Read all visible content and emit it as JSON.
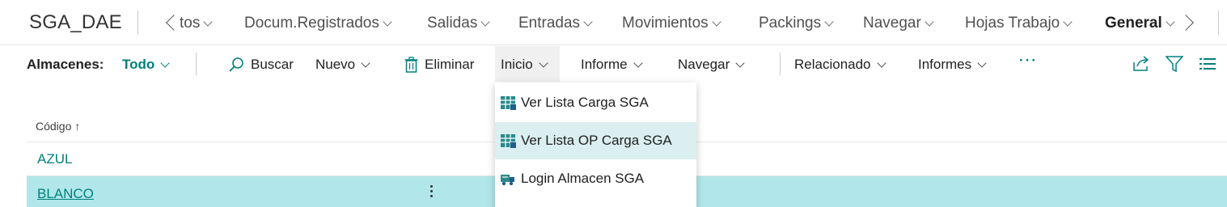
{
  "app": {
    "title": "SGA_DAE"
  },
  "topnav": {
    "items": [
      {
        "label": "tos"
      },
      {
        "label": "Docum.Registrados"
      },
      {
        "label": "Salidas"
      },
      {
        "label": "Entradas"
      },
      {
        "label": "Movimientos"
      },
      {
        "label": "Packings"
      },
      {
        "label": "Navegar"
      },
      {
        "label": "Hojas Trabajo"
      },
      {
        "label": "General"
      }
    ]
  },
  "actionbar": {
    "filter_label": "Almacenes:",
    "filter_value": "Todo",
    "buscar": "Buscar",
    "nuevo": "Nuevo",
    "eliminar": "Eliminar",
    "inicio": "Inicio",
    "informe": "Informe",
    "navegar": "Navegar",
    "relacionado": "Relacionado",
    "informes": "Informes",
    "more": "···"
  },
  "list": {
    "column_header": "Código",
    "sort_indicator": "↑",
    "rows": [
      {
        "code": "AZUL"
      },
      {
        "code": "BLANCO"
      }
    ]
  },
  "dropdown": {
    "items": [
      {
        "label": "Ver Lista Carga SGA",
        "icon": "grid-table-icon"
      },
      {
        "label": "Ver Lista OP Carga SGA",
        "icon": "grid-table-icon"
      },
      {
        "label": "Login Almacen SGA",
        "icon": "forklift-icon"
      }
    ]
  },
  "colors": {
    "accent": "#00807d",
    "selected_row": "#b1e7ea",
    "hover_item": "#dbeff0"
  }
}
